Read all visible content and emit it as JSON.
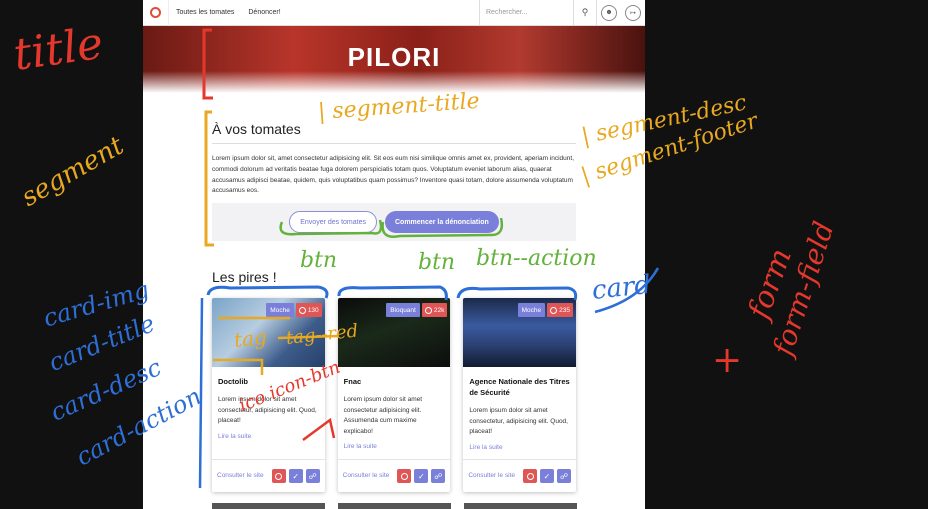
{
  "nav": {
    "links": [
      "Toutes les tomates",
      "Dénoncer!"
    ],
    "search_placeholder": "Rechercher..."
  },
  "hero": {
    "title": "PILORI"
  },
  "segment": {
    "title": "À vos tomates",
    "description": "Lorem ipsum dolor sit, amet consectetur adipisicing elit. Sit eos eum nisi similique omnis amet ex, provident, aperiam incidunt, commodi dolorum ad veritatis beatae fuga dolorem perspiciatis totam quos. Voluptatum eveniet laborum alias, quaerat accusamus adipisci beatae, quidem, quis voluptatibus quam possimus? Inventore quasi totam, dolore assumenda voluptatum accusamus eos.",
    "btn_secondary": "Envoyer des tomates",
    "btn_primary": "Commencer la dénonciation"
  },
  "section_title": "Les pires !",
  "cards": [
    {
      "tag": "Moche",
      "count": "130",
      "title": "Doctolib",
      "desc": "Lorem ipsum dolor sit amet consectetur, adipisicing elit. Quod, placeat!",
      "read_more": "Lire la suite",
      "site_link": "Consulter le site"
    },
    {
      "tag": "Bloquant",
      "count": "22k",
      "title": "Fnac",
      "desc": "Lorem ipsum dolor sit amet consectetur adipisicing elit. Assumenda cum maxime explicabo!",
      "read_more": "Lire la suite",
      "site_link": "Consulter le site"
    },
    {
      "tag": "Moche",
      "count": "235",
      "title": "Agence Nationale des Titres de Sécurité",
      "desc": "Lorem ipsum dolor sit amet consectetur, adipisicing elit. Quod, placeat!",
      "read_more": "Lire la suite",
      "site_link": "Consulter le site"
    }
  ],
  "annotations": {
    "title": "title",
    "segment": "segment",
    "segment_title": "| segment-title",
    "segment_desc": "| segment-desc",
    "segment_footer": "| segment-footer",
    "btn1": "btn",
    "btn2": "btn",
    "btn_action": "btn--action",
    "card": "card",
    "card_img": "card-img",
    "card_title": "card-title",
    "card_desc": "card-desc",
    "card_action": "card-action",
    "tag": "tag",
    "tag_red": "tag--red",
    "icon_btn": "ico icon-btn",
    "form_plus": "+",
    "form": "form",
    "form_field": "form-field"
  },
  "colors": {
    "accent": "#7a80d9",
    "danger": "#e05656",
    "ann_red": "#e5382c",
    "ann_yellow": "#e8a820",
    "ann_green": "#63b23c",
    "ann_blue": "#2d6fd6"
  }
}
